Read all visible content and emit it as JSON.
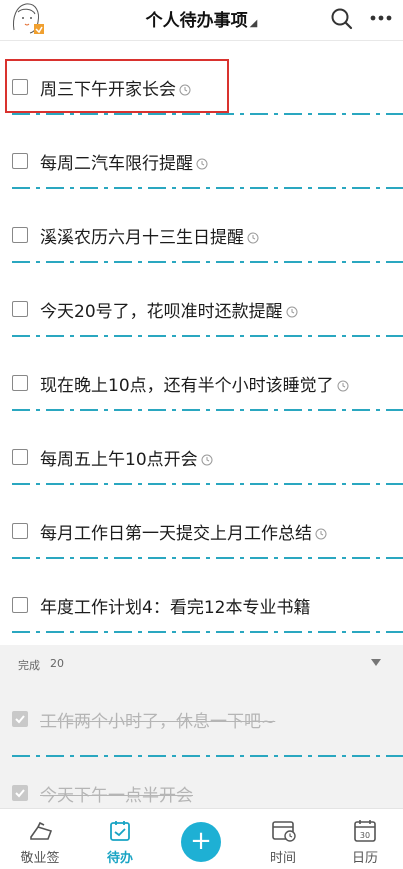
{
  "header": {
    "title": "个人待办事项",
    "title_caret": "◢",
    "avatar_icon": "avatar-girl-icon",
    "search_icon": "search-icon",
    "more_icon": "more-dots-icon"
  },
  "tasks": [
    {
      "text": "周三下午开家长会",
      "has_clock": true
    },
    {
      "text": "每周二汽车限行提醒",
      "has_clock": true
    },
    {
      "text": "溪溪农历六月十三生日提醒",
      "has_clock": true
    },
    {
      "text": "今天20号了，花呗准时还款提醒",
      "has_clock": true
    },
    {
      "text": "现在晚上10点，还有半个小时该睡觉了",
      "has_clock": true
    },
    {
      "text": "每周五上午10点开会",
      "has_clock": true
    },
    {
      "text": "每月工作日第一天提交上月工作总结",
      "has_clock": true
    },
    {
      "text": "年度工作计划4：看完12本专业书籍",
      "has_clock": false
    }
  ],
  "completed": {
    "label": "完成",
    "count": "20",
    "items": [
      {
        "text": "工作两个小时了，休息一下吧~"
      },
      {
        "text": "今天下午一点半开会"
      }
    ]
  },
  "nav": {
    "items": [
      {
        "label": "敬业签",
        "icon": "note-icon"
      },
      {
        "label": "待办",
        "icon": "todo-icon"
      },
      {
        "label": "+",
        "icon": "add-icon"
      },
      {
        "label": "时间",
        "icon": "time-icon"
      },
      {
        "label": "日历",
        "icon": "calendar-icon"
      }
    ],
    "calendar_day": "30"
  },
  "colors": {
    "accent": "#1eb0d4",
    "separator": "#2aa7c0",
    "highlight": "#d9322e"
  }
}
